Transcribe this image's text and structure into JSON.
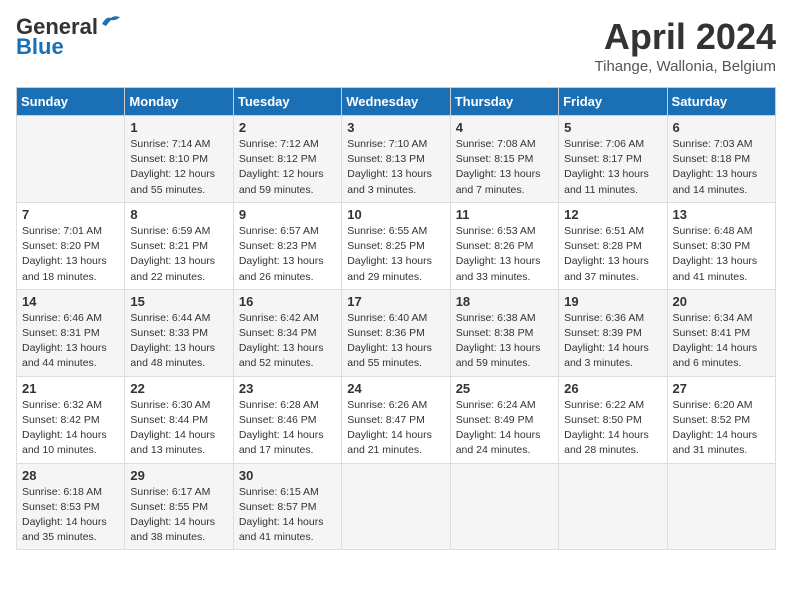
{
  "logo": {
    "general": "General",
    "blue": "Blue"
  },
  "title": "April 2024",
  "location": "Tihange, Wallonia, Belgium",
  "days_of_week": [
    "Sunday",
    "Monday",
    "Tuesday",
    "Wednesday",
    "Thursday",
    "Friday",
    "Saturday"
  ],
  "weeks": [
    [
      {
        "day": "",
        "info": ""
      },
      {
        "day": "1",
        "info": "Sunrise: 7:14 AM\nSunset: 8:10 PM\nDaylight: 12 hours\nand 55 minutes."
      },
      {
        "day": "2",
        "info": "Sunrise: 7:12 AM\nSunset: 8:12 PM\nDaylight: 12 hours\nand 59 minutes."
      },
      {
        "day": "3",
        "info": "Sunrise: 7:10 AM\nSunset: 8:13 PM\nDaylight: 13 hours\nand 3 minutes."
      },
      {
        "day": "4",
        "info": "Sunrise: 7:08 AM\nSunset: 8:15 PM\nDaylight: 13 hours\nand 7 minutes."
      },
      {
        "day": "5",
        "info": "Sunrise: 7:06 AM\nSunset: 8:17 PM\nDaylight: 13 hours\nand 11 minutes."
      },
      {
        "day": "6",
        "info": "Sunrise: 7:03 AM\nSunset: 8:18 PM\nDaylight: 13 hours\nand 14 minutes."
      }
    ],
    [
      {
        "day": "7",
        "info": "Sunrise: 7:01 AM\nSunset: 8:20 PM\nDaylight: 13 hours\nand 18 minutes."
      },
      {
        "day": "8",
        "info": "Sunrise: 6:59 AM\nSunset: 8:21 PM\nDaylight: 13 hours\nand 22 minutes."
      },
      {
        "day": "9",
        "info": "Sunrise: 6:57 AM\nSunset: 8:23 PM\nDaylight: 13 hours\nand 26 minutes."
      },
      {
        "day": "10",
        "info": "Sunrise: 6:55 AM\nSunset: 8:25 PM\nDaylight: 13 hours\nand 29 minutes."
      },
      {
        "day": "11",
        "info": "Sunrise: 6:53 AM\nSunset: 8:26 PM\nDaylight: 13 hours\nand 33 minutes."
      },
      {
        "day": "12",
        "info": "Sunrise: 6:51 AM\nSunset: 8:28 PM\nDaylight: 13 hours\nand 37 minutes."
      },
      {
        "day": "13",
        "info": "Sunrise: 6:48 AM\nSunset: 8:30 PM\nDaylight: 13 hours\nand 41 minutes."
      }
    ],
    [
      {
        "day": "14",
        "info": "Sunrise: 6:46 AM\nSunset: 8:31 PM\nDaylight: 13 hours\nand 44 minutes."
      },
      {
        "day": "15",
        "info": "Sunrise: 6:44 AM\nSunset: 8:33 PM\nDaylight: 13 hours\nand 48 minutes."
      },
      {
        "day": "16",
        "info": "Sunrise: 6:42 AM\nSunset: 8:34 PM\nDaylight: 13 hours\nand 52 minutes."
      },
      {
        "day": "17",
        "info": "Sunrise: 6:40 AM\nSunset: 8:36 PM\nDaylight: 13 hours\nand 55 minutes."
      },
      {
        "day": "18",
        "info": "Sunrise: 6:38 AM\nSunset: 8:38 PM\nDaylight: 13 hours\nand 59 minutes."
      },
      {
        "day": "19",
        "info": "Sunrise: 6:36 AM\nSunset: 8:39 PM\nDaylight: 14 hours\nand 3 minutes."
      },
      {
        "day": "20",
        "info": "Sunrise: 6:34 AM\nSunset: 8:41 PM\nDaylight: 14 hours\nand 6 minutes."
      }
    ],
    [
      {
        "day": "21",
        "info": "Sunrise: 6:32 AM\nSunset: 8:42 PM\nDaylight: 14 hours\nand 10 minutes."
      },
      {
        "day": "22",
        "info": "Sunrise: 6:30 AM\nSunset: 8:44 PM\nDaylight: 14 hours\nand 13 minutes."
      },
      {
        "day": "23",
        "info": "Sunrise: 6:28 AM\nSunset: 8:46 PM\nDaylight: 14 hours\nand 17 minutes."
      },
      {
        "day": "24",
        "info": "Sunrise: 6:26 AM\nSunset: 8:47 PM\nDaylight: 14 hours\nand 21 minutes."
      },
      {
        "day": "25",
        "info": "Sunrise: 6:24 AM\nSunset: 8:49 PM\nDaylight: 14 hours\nand 24 minutes."
      },
      {
        "day": "26",
        "info": "Sunrise: 6:22 AM\nSunset: 8:50 PM\nDaylight: 14 hours\nand 28 minutes."
      },
      {
        "day": "27",
        "info": "Sunrise: 6:20 AM\nSunset: 8:52 PM\nDaylight: 14 hours\nand 31 minutes."
      }
    ],
    [
      {
        "day": "28",
        "info": "Sunrise: 6:18 AM\nSunset: 8:53 PM\nDaylight: 14 hours\nand 35 minutes."
      },
      {
        "day": "29",
        "info": "Sunrise: 6:17 AM\nSunset: 8:55 PM\nDaylight: 14 hours\nand 38 minutes."
      },
      {
        "day": "30",
        "info": "Sunrise: 6:15 AM\nSunset: 8:57 PM\nDaylight: 14 hours\nand 41 minutes."
      },
      {
        "day": "",
        "info": ""
      },
      {
        "day": "",
        "info": ""
      },
      {
        "day": "",
        "info": ""
      },
      {
        "day": "",
        "info": ""
      }
    ]
  ]
}
